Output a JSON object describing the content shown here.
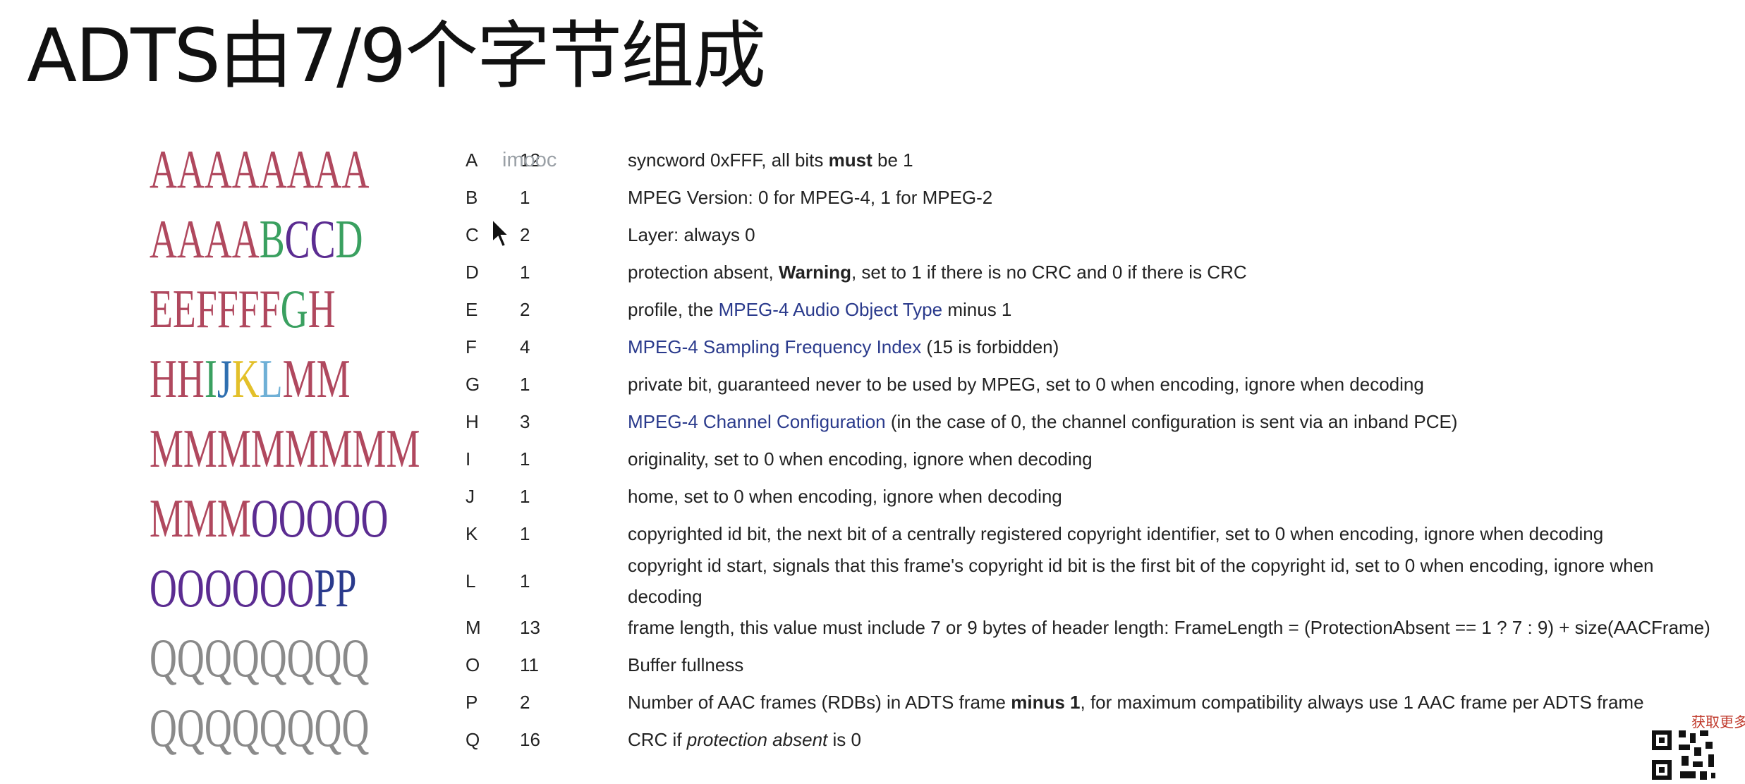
{
  "title": "ADTS由7/9个字节组成",
  "watermark": "imooc",
  "bit_layout": [
    [
      {
        "t": "AAAAAAAA",
        "c": "#b0485e"
      }
    ],
    [
      {
        "t": "AAAA",
        "c": "#b0485e"
      },
      {
        "t": "B",
        "c": "#3aa060"
      },
      {
        "t": "CC",
        "c": "#5b2c91"
      },
      {
        "t": "D",
        "c": "#3aa060"
      }
    ],
    [
      {
        "t": "EE",
        "c": "#b0485e"
      },
      {
        "t": "FFFF",
        "c": "#b0485e"
      },
      {
        "t": "G",
        "c": "#3aa060"
      },
      {
        "t": "H",
        "c": "#b0485e"
      }
    ],
    [
      {
        "t": "HH",
        "c": "#b0485e"
      },
      {
        "t": "I",
        "c": "#3aa060"
      },
      {
        "t": "J",
        "c": "#2f6fb0"
      },
      {
        "t": "K",
        "c": "#e3c02a"
      },
      {
        "t": "L",
        "c": "#6fb0d6"
      },
      {
        "t": "MM",
        "c": "#b0485e"
      }
    ],
    [
      {
        "t": "MMMMMMMM",
        "c": "#b0485e"
      }
    ],
    [
      {
        "t": "MMM",
        "c": "#b0485e"
      },
      {
        "t": "OOOOO",
        "c": "#5b2c91"
      }
    ],
    [
      {
        "t": "OOOOOO",
        "c": "#5b2c91"
      },
      {
        "t": "PP",
        "c": "#2a3a8c"
      }
    ],
    [
      {
        "t": "QQQQQQQQ",
        "c": "#8a8a8a"
      }
    ],
    [
      {
        "t": "QQQQQQQQ",
        "c": "#8a8a8a"
      }
    ]
  ],
  "fields": [
    {
      "letter": "A",
      "bits": "12",
      "desc": [
        {
          "t": "syncword 0xFFF, all bits "
        },
        {
          "t": "must",
          "b": true
        },
        {
          "t": " be 1"
        }
      ]
    },
    {
      "letter": "B",
      "bits": "1",
      "desc": [
        {
          "t": "MPEG Version: 0 for MPEG-4, 1 for MPEG-2"
        }
      ]
    },
    {
      "letter": "C",
      "bits": "2",
      "desc": [
        {
          "t": "Layer: always 0"
        }
      ]
    },
    {
      "letter": "D",
      "bits": "1",
      "desc": [
        {
          "t": "protection absent, "
        },
        {
          "t": "Warning",
          "b": true
        },
        {
          "t": ", set to 1 if there is no CRC and 0 if there is CRC"
        }
      ]
    },
    {
      "letter": "E",
      "bits": "2",
      "desc": [
        {
          "t": "profile, the "
        },
        {
          "t": "MPEG-4 Audio Object Type",
          "link": true
        },
        {
          "t": " minus 1"
        }
      ]
    },
    {
      "letter": "F",
      "bits": "4",
      "desc": [
        {
          "t": "MPEG-4 Sampling Frequency Index",
          "link": true
        },
        {
          "t": " (15 is forbidden)"
        }
      ]
    },
    {
      "letter": "G",
      "bits": "1",
      "desc": [
        {
          "t": "private bit, guaranteed never to be used by MPEG, set to 0 when encoding, ignore when decoding"
        }
      ]
    },
    {
      "letter": "H",
      "bits": "3",
      "desc": [
        {
          "t": "MPEG-4 Channel Configuration",
          "link": true
        },
        {
          "t": " (in the case of 0, the channel configuration is sent via an inband PCE)"
        }
      ]
    },
    {
      "letter": "I",
      "bits": "1",
      "desc": [
        {
          "t": "originality, set to 0 when encoding, ignore when decoding"
        }
      ]
    },
    {
      "letter": "J",
      "bits": "1",
      "desc": [
        {
          "t": "home, set to 0 when encoding, ignore when decoding"
        }
      ]
    },
    {
      "letter": "K",
      "bits": "1",
      "desc": [
        {
          "t": "copyrighted id bit, the next bit of a centrally registered copyright identifier, set to 0 when encoding, ignore when decoding"
        }
      ]
    },
    {
      "letter": "L",
      "bits": "1",
      "tall": true,
      "desc": [
        {
          "t": "copyright id start, signals that this frame's copyright id bit is the first bit of the copyright id, set to 0 when encoding, ignore when decoding"
        }
      ]
    },
    {
      "letter": "M",
      "bits": "13",
      "desc": [
        {
          "t": "frame length, this value must include 7 or 9 bytes of header length: FrameLength = (ProtectionAbsent == 1 ? 7 : 9) + size(AACFrame)"
        }
      ]
    },
    {
      "letter": "O",
      "bits": "11",
      "desc": [
        {
          "t": "Buffer fullness"
        }
      ]
    },
    {
      "letter": "P",
      "bits": "2",
      "desc": [
        {
          "t": "Number of AAC frames (RDBs) in ADTS frame "
        },
        {
          "t": "minus 1",
          "b": true
        },
        {
          "t": ", for maximum compatibility always use 1 AAC frame per ADTS frame"
        }
      ]
    },
    {
      "letter": "Q",
      "bits": "16",
      "desc": [
        {
          "t": "CRC if "
        },
        {
          "t": "protection absent",
          "i": true
        },
        {
          "t": " is 0"
        }
      ]
    }
  ],
  "qr_label": "获取更多"
}
